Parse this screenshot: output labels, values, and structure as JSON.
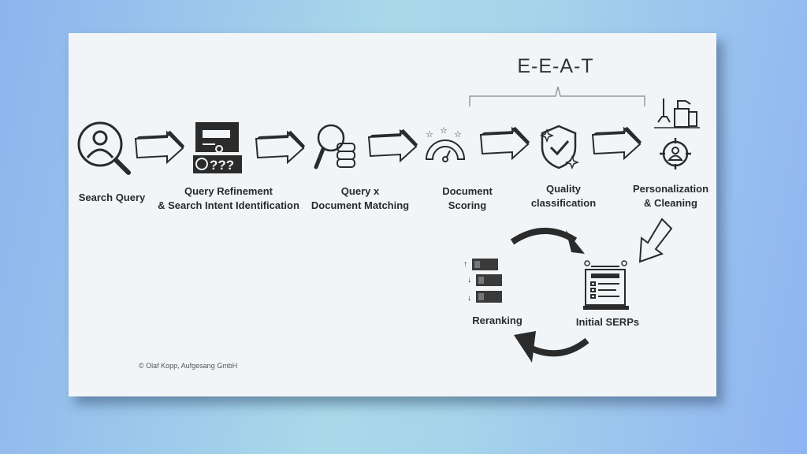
{
  "title": "E-E-A-T",
  "steps": [
    {
      "label_1": "Search Query",
      "label_2": "",
      "icon": "search-user-icon"
    },
    {
      "label_1": "Query Refinement",
      "label_2": "& Search Intent Identification",
      "icon": "browser-query-icon"
    },
    {
      "label_1": "Query x",
      "label_2": "Document Matching",
      "icon": "search-database-icon"
    },
    {
      "label_1": "Document",
      "label_2": "Scoring",
      "icon": "gauge-stars-icon"
    },
    {
      "label_1": "Quality",
      "label_2": "classification",
      "icon": "shield-check-icon"
    },
    {
      "label_1": "Personalization",
      "label_2": "& Cleaning",
      "icon": "target-user-cleaning-icon"
    }
  ],
  "loop": {
    "reranking": "Reranking",
    "initial_serps": "Initial SERPs"
  },
  "copyright": "© Olaf Kopp, Aufgesang GmbH",
  "colors": {
    "icon": "#2b2b2b",
    "card": "#f1f5f8"
  }
}
